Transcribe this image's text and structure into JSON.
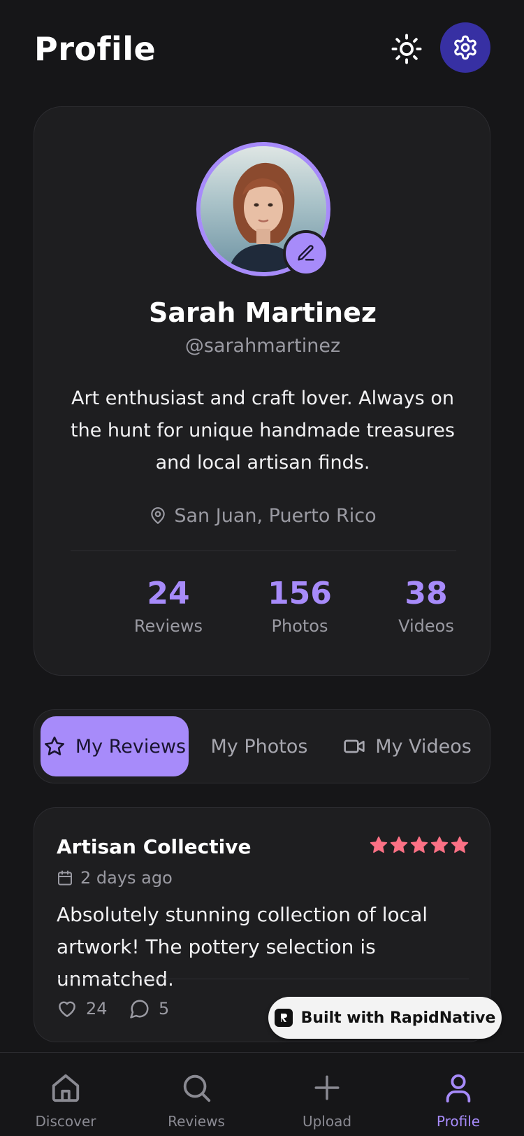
{
  "header": {
    "title": "Profile",
    "theme_icon": "sun-icon",
    "settings_icon": "gear-icon"
  },
  "profile": {
    "name": "Sarah Martinez",
    "handle": "@sarahmartinez",
    "bio": "Art enthusiast and craft lover. Always on the hunt for unique handmade treasures and local artisan finds.",
    "location": "San Juan, Puerto Rico",
    "stats": [
      {
        "value": "24",
        "label": "Reviews"
      },
      {
        "value": "156",
        "label": "Photos"
      },
      {
        "value": "38",
        "label": "Videos"
      }
    ]
  },
  "tabs": [
    {
      "label": "My Reviews",
      "icon": "star-outline-icon",
      "active": true
    },
    {
      "label": "My Photos",
      "icon": "",
      "active": false
    },
    {
      "label": "My Videos",
      "icon": "video-camera-icon",
      "active": false
    }
  ],
  "review": {
    "title": "Artisan Collective",
    "rating": 5,
    "max_rating": 5,
    "date": "2 days ago",
    "text": "Absolutely stunning collection of local artwork! The pottery selection is unmatched.",
    "likes": "24",
    "comments": "5"
  },
  "badge": {
    "label": "Built with RapidNative"
  },
  "nav": [
    {
      "label": "Discover",
      "icon": "home-icon",
      "active": false
    },
    {
      "label": "Reviews",
      "icon": "search-icon",
      "active": false
    },
    {
      "label": "Upload",
      "icon": "plus-icon",
      "active": false
    },
    {
      "label": "Profile",
      "icon": "user-icon",
      "active": true
    }
  ],
  "colors": {
    "background": "#161618",
    "card": "#1e1e20",
    "accent": "#a78bfa",
    "settings_button": "#3730a3",
    "star": "#fb7185",
    "muted_text": "#9a9aa2"
  }
}
